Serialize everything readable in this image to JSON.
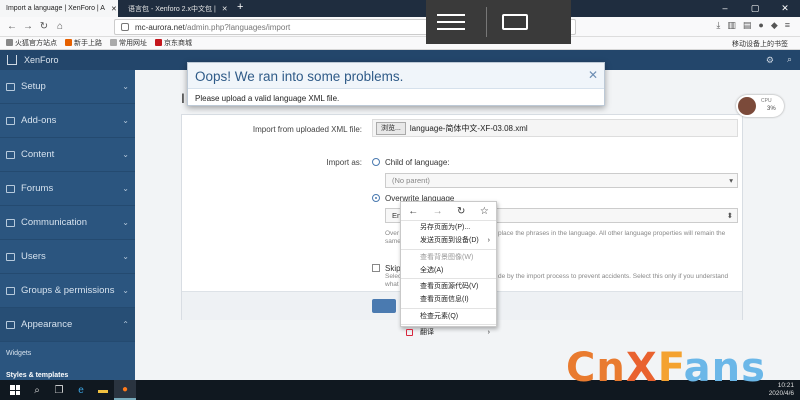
{
  "browser": {
    "tabs": [
      {
        "title": "Import a language | XenForo | A",
        "active": true
      },
      {
        "title": "语言包 - Xenforo 2.x中文包 |",
        "active": false
      }
    ],
    "new_tab": "+",
    "url_host": "mc-aurora.net",
    "url_path": "/admin.php?languages/import",
    "more_icon": "···",
    "bookmarks": [
      "火狐官方站点",
      "新手上路",
      "常用网址",
      "京东商城"
    ],
    "bookmarks_right": "移动设备上的书签"
  },
  "app": {
    "brand": "XenForo",
    "sidebar": [
      {
        "label": "Setup",
        "icon": "wrench-icon"
      },
      {
        "label": "Add-ons",
        "icon": "puzzle-icon"
      },
      {
        "label": "Content",
        "icon": "content-icon"
      },
      {
        "label": "Forums",
        "icon": "forum-icon"
      },
      {
        "label": "Communication",
        "icon": "megaphone-icon"
      },
      {
        "label": "Users",
        "icon": "users-icon"
      },
      {
        "label": "Groups & permissions",
        "icon": "groups-icon"
      },
      {
        "label": "Appearance",
        "icon": "appearance-icon"
      }
    ],
    "sub_items": [
      "Widgets",
      "Styles & templates"
    ],
    "page_title": "I",
    "form": {
      "import_label": "Import from uploaded XML file:",
      "browse_btn": "浏览...",
      "file_name": "language-简体中文-XF-03.08.xml",
      "import_as_label": "Import as:",
      "child_option": "Child of language:",
      "no_parent": "(No parent)",
      "overwrite_option": "Overwrite language",
      "overwrite_select": "Eng",
      "hint_overwrite_a": "Over",
      "hint_overwrite_b": "place the phrases in the language. All other language properties will remain the",
      "hint_overwrite_c": "same",
      "skip_label": "Skip",
      "hint_skip_a": "Selec",
      "hint_skip_b": "de by the import process to prevent accidents. Select this only if you understand",
      "hint_skip_c": "what"
    },
    "cpu": {
      "label": "CPU",
      "value": "3%"
    }
  },
  "dialog": {
    "title": "Oops! We ran into some problems.",
    "message": "Please upload a valid language XML file.",
    "close": "✕"
  },
  "context_menu": {
    "items": [
      {
        "label": "另存页面为(P)...",
        "disabled": false
      },
      {
        "label": "发送页面到设备(D)",
        "disabled": false,
        "submenu": true
      },
      {
        "label": "查看背景图像(W)",
        "disabled": true
      },
      {
        "label": "全选(A)",
        "disabled": false
      },
      {
        "label": "查看页面源代码(V)",
        "disabled": false
      },
      {
        "label": "查看页面信息(I)",
        "disabled": false
      },
      {
        "label": "检查元素(Q)",
        "disabled": false
      },
      {
        "label": "翻译",
        "disabled": false,
        "submenu": true
      }
    ]
  },
  "taskbar": {
    "time": "10:21",
    "date": "2020/4/6"
  },
  "watermark": {
    "part1": "Cn",
    "part2": "X",
    "part3": "F",
    "part4": "ans"
  }
}
